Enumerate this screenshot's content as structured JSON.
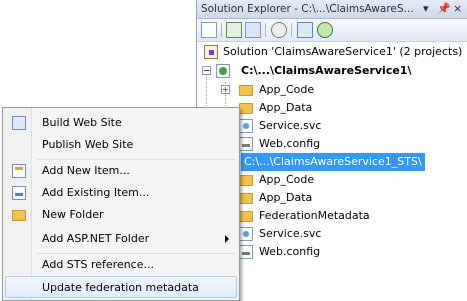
{
  "solution_explorer": {
    "title": "Solution Explorer - C:\\...\\ClaimsAwareS...",
    "pin_icon": "pin-icon",
    "close_label": "×",
    "tree": {
      "solution_label": "Solution 'ClaimsAwareService1' (2 projects)",
      "project1_label": "C:\\...\\ClaimsAwareService1\\",
      "p1_app_code": "App_Code",
      "p1_app_data": "App_Data",
      "p1_service_svc": "Service.svc",
      "p1_web_config": "Web.config",
      "project2_label": "C:\\...\\ClaimsAwareService1_STS\\",
      "p2_app_code": "App_Code",
      "p2_app_data": "App_Data",
      "p2_federation_metadata": "FederationMetadata",
      "p2_service_svc": "Service.svc",
      "p2_web_config": "Web.config"
    }
  },
  "context_menu": {
    "build_web_site": "Build Web Site",
    "publish_web_site": "Publish Web Site",
    "add_new_item": "Add New Item...",
    "add_existing_item": "Add Existing Item...",
    "new_folder": "New Folder",
    "add_aspnet_folder": "Add ASP.NET Folder",
    "add_sts_reference": "Add STS reference...",
    "update_federation_metadata": "Update federation metadata"
  },
  "colors": {
    "selection": "#3399ff",
    "menu_highlight": "#e1ecfa"
  }
}
